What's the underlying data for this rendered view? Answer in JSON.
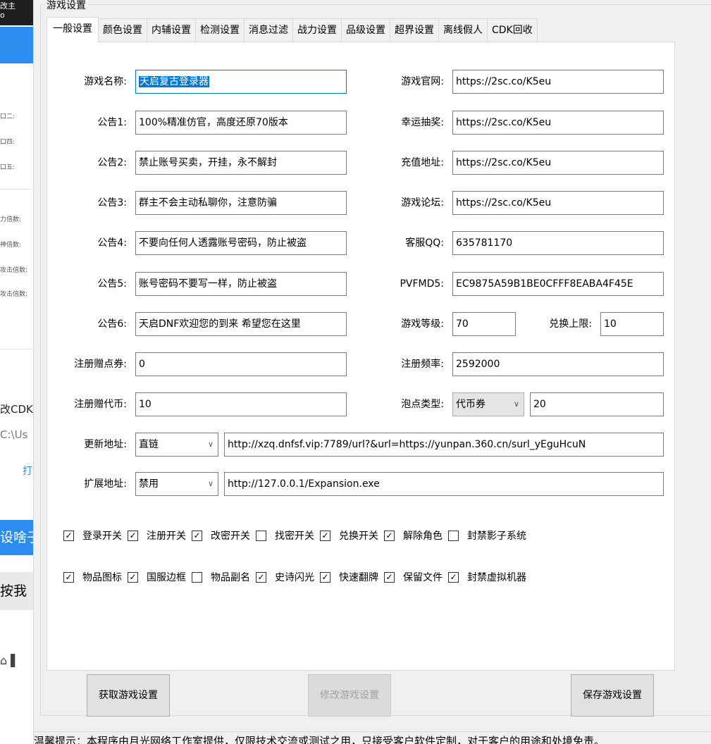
{
  "left_panel": {
    "top_text": "改主",
    "top_text2": "o",
    "rows_small_a": [
      "口二:",
      "口四:",
      "口五:"
    ],
    "rows_small_b": [
      "力倍数:",
      "神倍数:",
      "攻击倍数:",
      "攻击倍数:"
    ],
    "cdk_label": "改CDK",
    "path_label": "C:\\Us",
    "open_button": "打开",
    "blue_text": "设啥子",
    "gray_text": "按我",
    "icons_text": "⌂ ▌"
  },
  "group_title": "游戏设置",
  "tabs": [
    {
      "label": "一般设置",
      "active": true
    },
    {
      "label": "颜色设置"
    },
    {
      "label": "内辅设置"
    },
    {
      "label": "检测设置"
    },
    {
      "label": "消息过滤"
    },
    {
      "label": "战力设置"
    },
    {
      "label": "品级设置"
    },
    {
      "label": "超界设置"
    },
    {
      "label": "离线假人"
    },
    {
      "label": "CDK回收"
    }
  ],
  "left_fields": [
    {
      "label": "游戏名称:",
      "value": "天启复古登录器"
    },
    {
      "label": "公告1:",
      "value": "100%精准仿官，高度还原70版本"
    },
    {
      "label": "公告2:",
      "value": "禁止账号买卖，开挂，永不解封"
    },
    {
      "label": "公告3:",
      "value": "群主不会主动私聊你，注意防骗"
    },
    {
      "label": "公告4:",
      "value": "不要向任何人透露账号密码，防止被盗"
    },
    {
      "label": "公告5:",
      "value": "账号密码不要写一样，防止被盗"
    },
    {
      "label": "公告6:",
      "value": "天启DNF欢迎您的到来 希望您在这里"
    },
    {
      "label": "注册赠点券:",
      "value": "0"
    },
    {
      "label": "注册赠代币:",
      "value": "10"
    }
  ],
  "right_fields": [
    {
      "label": "游戏官网:",
      "value": "https://2sc.co/K5eu"
    },
    {
      "label": "幸运抽奖:",
      "value": "https://2sc.co/K5eu"
    },
    {
      "label": "充值地址:",
      "value": "https://2sc.co/K5eu"
    },
    {
      "label": "游戏论坛:",
      "value": "https://2sc.co/K5eu"
    },
    {
      "label": "客服QQ:",
      "value": "635781170"
    },
    {
      "label": "PVFMD5:",
      "value": "EC9875A59B1BE0CFFF8EABA4F45E"
    }
  ],
  "game_level": {
    "label": "游戏等级:",
    "value": "70"
  },
  "exchange_limit": {
    "label": "兑换上限:",
    "value": "10"
  },
  "register_freq": {
    "label": "注册频率:",
    "value": "2592000"
  },
  "bubble_type": {
    "label": "泡点类型:",
    "selected": "代币券",
    "value": "20"
  },
  "update_url": {
    "label": "更新地址:",
    "mode": "直链",
    "value": "http://xzq.dnfsf.vip:7789/url?&url=https://yunpan.360.cn/surl_yEguHcuN"
  },
  "expand_url": {
    "label": "扩展地址:",
    "mode": "禁用",
    "value": "http://127.0.0.1/Expansion.exe"
  },
  "checkbox_row1": [
    {
      "label": "登录开关",
      "checked": true
    },
    {
      "label": "注册开关",
      "checked": true
    },
    {
      "label": "改密开关",
      "checked": true
    },
    {
      "label": "找密开关",
      "checked": false
    },
    {
      "label": "兑换开关",
      "checked": true
    },
    {
      "label": "解除角色",
      "checked": true
    },
    {
      "label": "封禁影子系统",
      "checked": false
    }
  ],
  "checkbox_row2": [
    {
      "label": "物品图标",
      "checked": true
    },
    {
      "label": "国服边框",
      "checked": true
    },
    {
      "label": "物品副名",
      "checked": false
    },
    {
      "label": "史诗闪光",
      "checked": true
    },
    {
      "label": "快速翻牌",
      "checked": true
    },
    {
      "label": "保留文件",
      "checked": true
    },
    {
      "label": "封禁虚拟机器",
      "checked": true
    }
  ],
  "buttons": {
    "get": "获取游戏设置",
    "modify": "修改游戏设置",
    "save": "保存游戏设置"
  },
  "footer": "温馨提示：本程序由月光网络工作室提供，仅限技术交流或测试之用，只接受客户软件定制，对于客户的用途和处境免责。",
  "colors": {
    "accent": "#0078d7",
    "side_blue": "#2d8cf0"
  }
}
